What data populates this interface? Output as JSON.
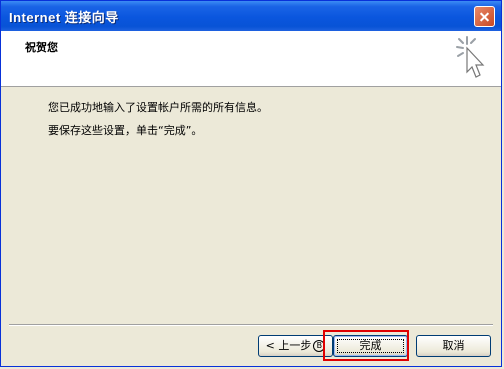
{
  "window": {
    "title": "Internet 连接向导"
  },
  "header": {
    "title": "祝贺您"
  },
  "content": {
    "line1": "您已成功地输入了设置帐户所需的所有信息。",
    "line2": "要保存这些设置，单击“完成”。"
  },
  "buttons": {
    "back_label": "< 上一步",
    "back_mnemonic": "B",
    "finish_label": "完成",
    "cancel_label": "取消"
  },
  "colors": {
    "titlebar": "#0a56de",
    "highlight": "#e00000"
  },
  "icons": {
    "close": "close-icon",
    "wizard": "wizard-burst-cursor-icon"
  }
}
